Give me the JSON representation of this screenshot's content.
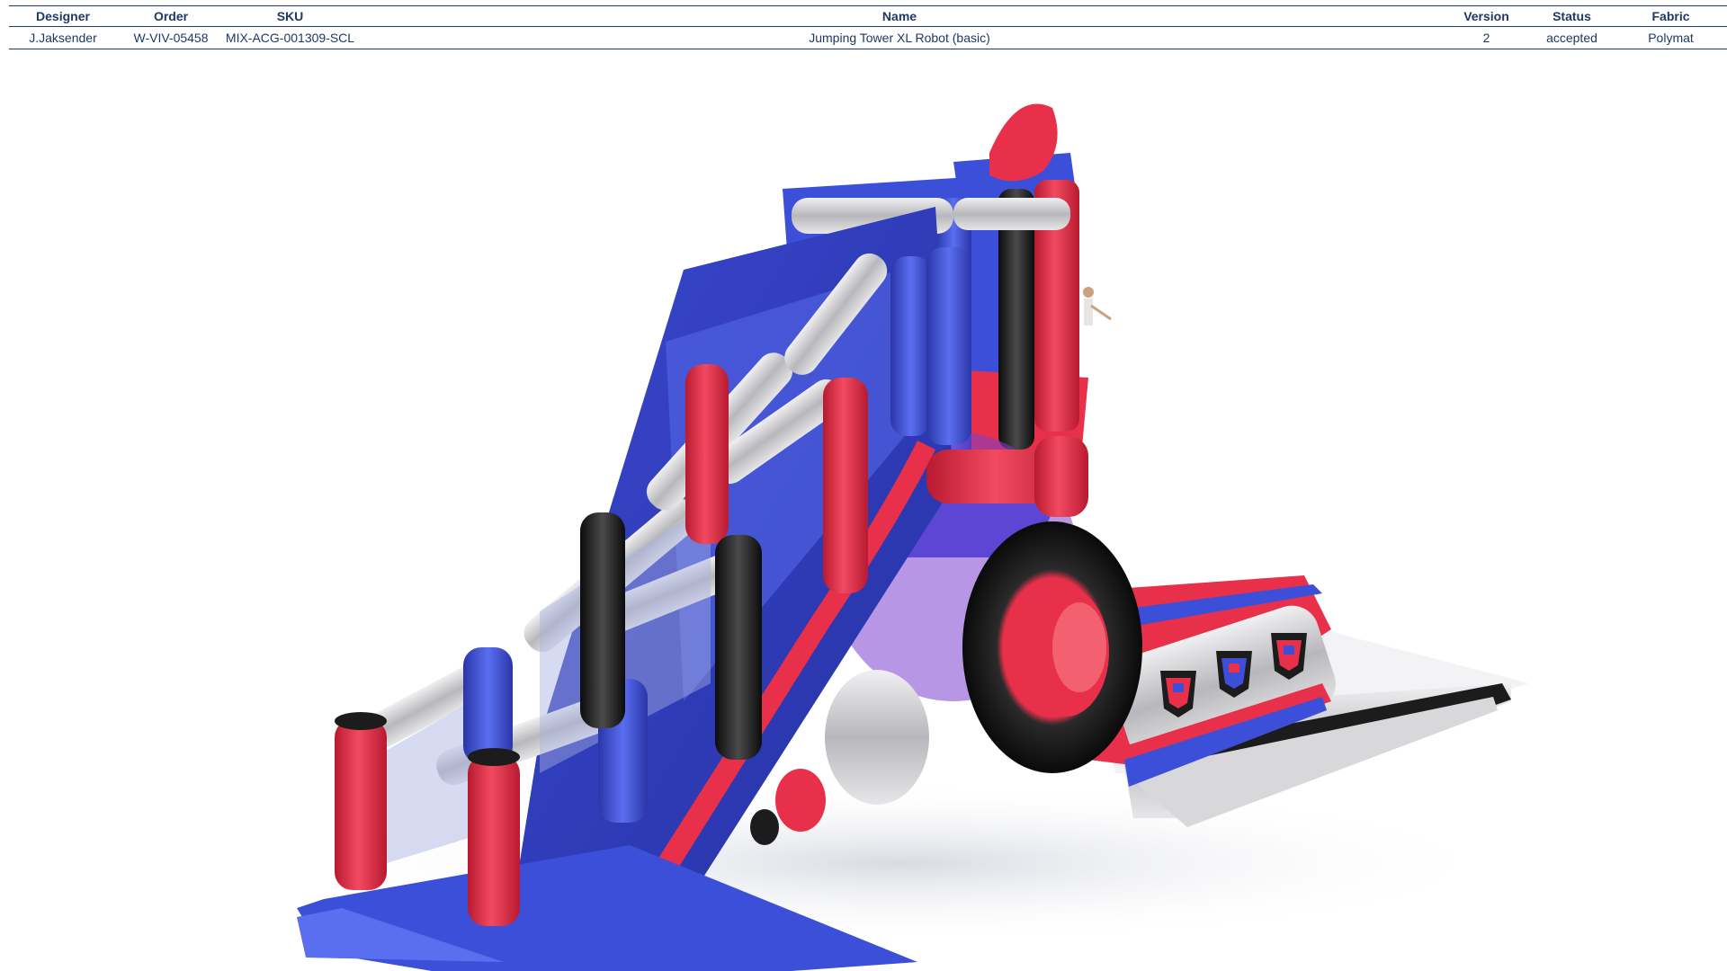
{
  "table": {
    "headers": {
      "designer": "Designer",
      "order": "Order",
      "sku": "SKU",
      "name": "Name",
      "version": "Version",
      "status": "Status",
      "fabric": "Fabric"
    },
    "row": {
      "designer": "J.Jaksender",
      "order": "W-VIV-05458",
      "sku": "MIX-ACG-001309-SCL",
      "name": "Jumping Tower XL Robot (basic)",
      "version": "2",
      "status": "accepted",
      "fabric": "Polymat"
    }
  },
  "product_render": {
    "description_icon": "inflatable-robot-slide-render",
    "colors": {
      "red": "#e8304a",
      "blue": "#3b4fd8",
      "grey": "#c9c9cc",
      "black": "#1c1c1c"
    }
  }
}
